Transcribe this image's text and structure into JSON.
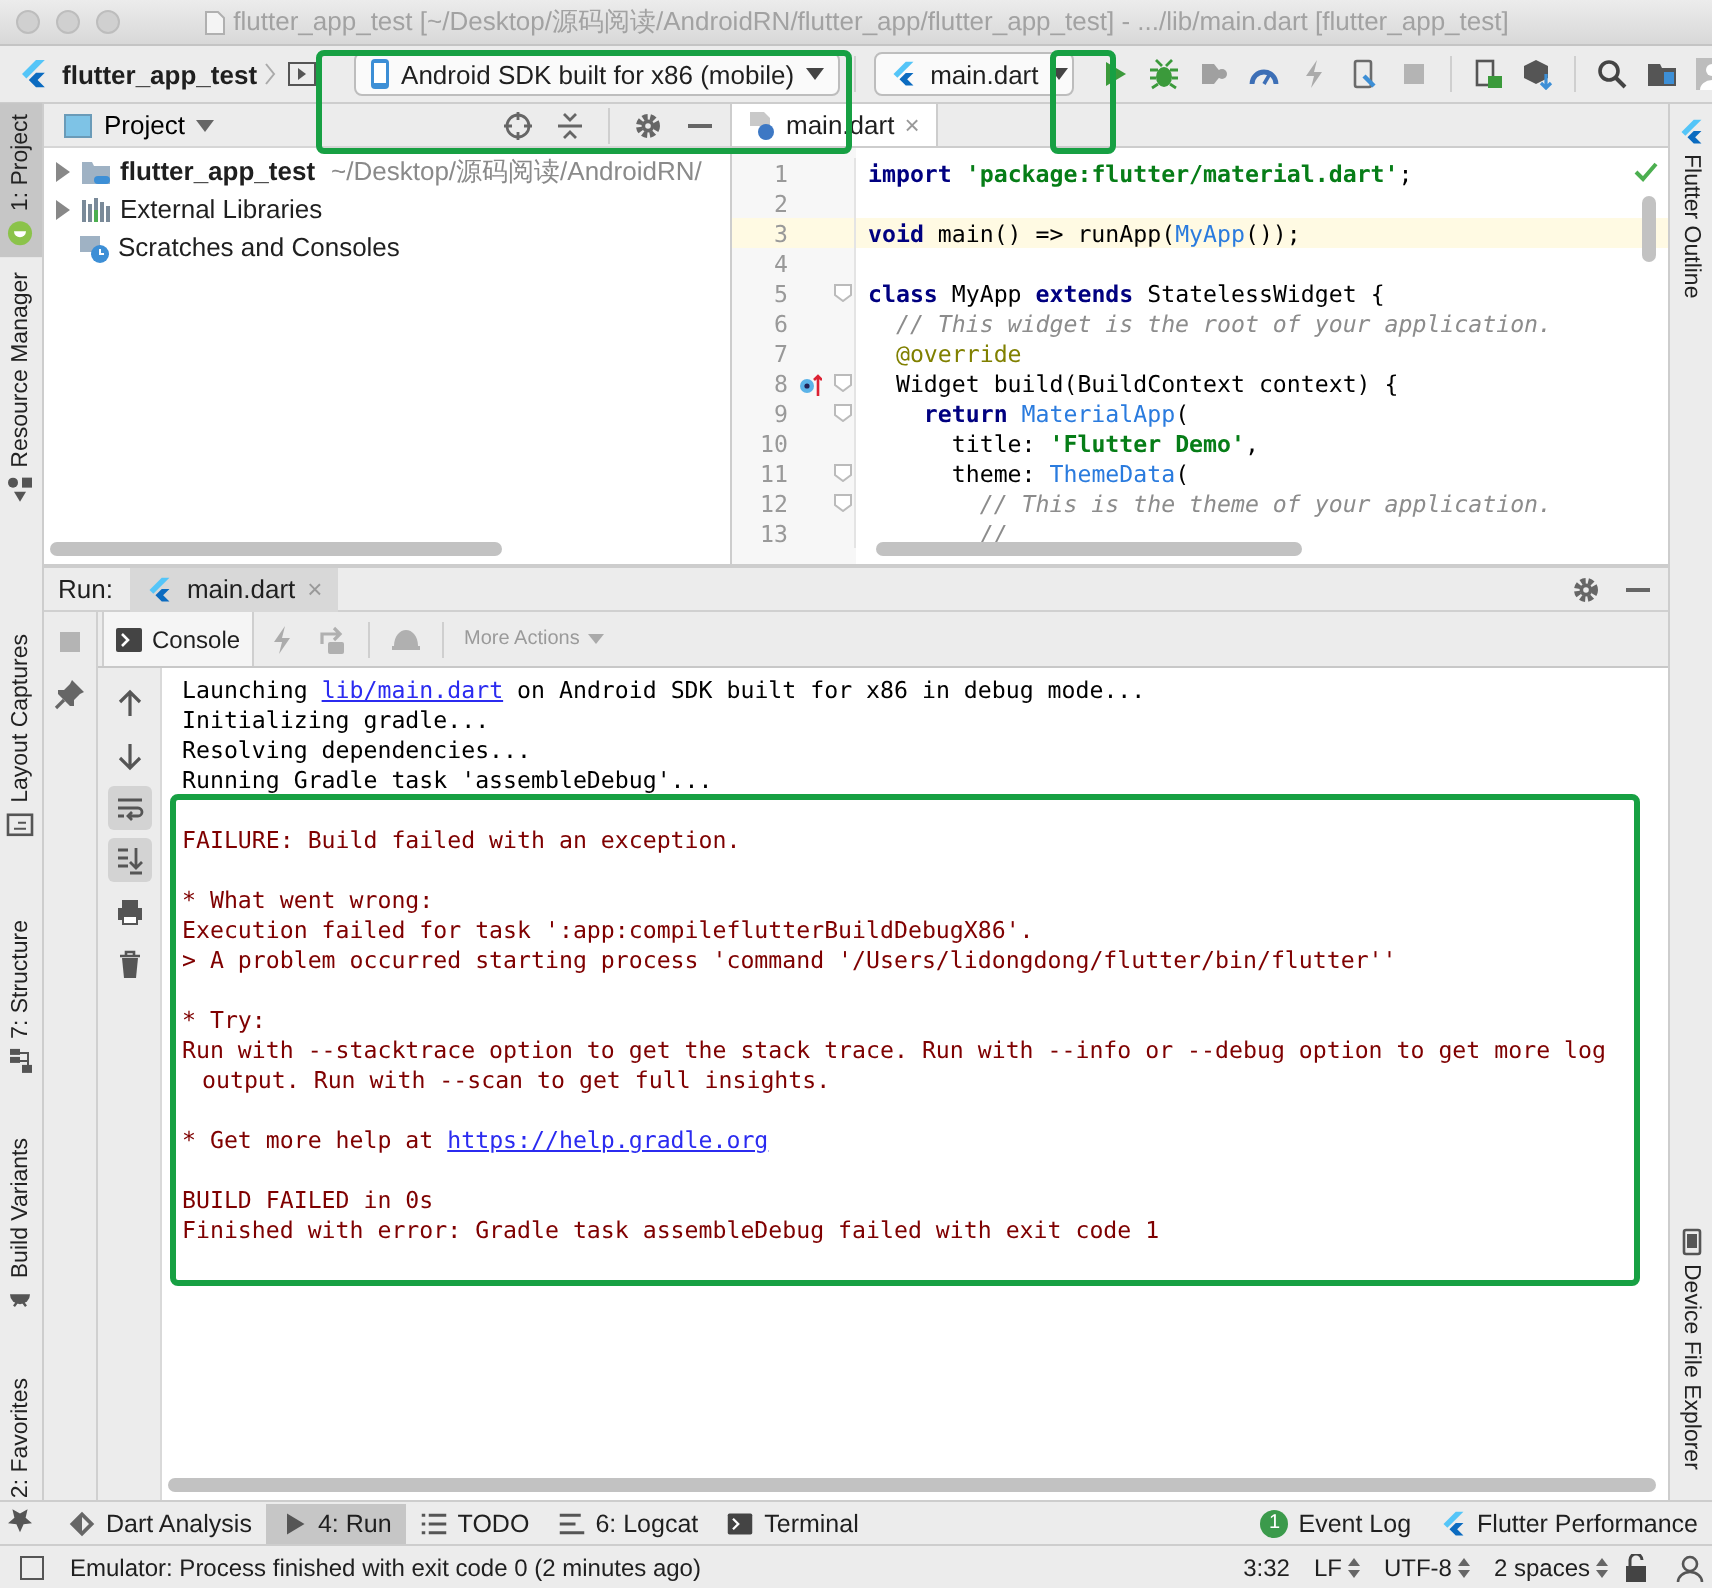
{
  "window": {
    "title": "flutter_app_test [~/Desktop/源码阅读/AndroidRN/flutter_app/flutter_app_test] - .../lib/main.dart [flutter_app_test]"
  },
  "toolbar": {
    "project": "flutter_app_test",
    "device": "Android SDK built for x86 (mobile)",
    "run_config": "main.dart"
  },
  "left_stripe": [
    {
      "label": "1: Project",
      "selected": true,
      "kind": "project"
    },
    {
      "label": "Resource Manager",
      "selected": false,
      "kind": "resources"
    },
    {
      "label": "Layout Captures",
      "selected": false,
      "kind": "captures"
    },
    {
      "label": "7: Structure",
      "selected": false,
      "kind": "structure"
    },
    {
      "label": "Build Variants",
      "selected": false,
      "kind": "variants"
    },
    {
      "label": "2: Favorites",
      "selected": false,
      "kind": "favorites"
    }
  ],
  "right_stripe": [
    {
      "label": "Flutter Outline",
      "selected": false,
      "kind": "outline"
    },
    {
      "label": "Device File Explorer",
      "selected": false,
      "kind": "device"
    }
  ],
  "project_panel": {
    "title": "Project",
    "tree": [
      {
        "name": "flutter_app_test",
        "path": "~/Desktop/源码阅读/AndroidRN/",
        "expanded": false,
        "kind": "module"
      },
      {
        "name": "External Libraries",
        "expanded": false,
        "kind": "libraries"
      },
      {
        "name": "Scratches and Consoles",
        "kind": "scratches"
      }
    ]
  },
  "editor": {
    "tabs": [
      {
        "label": "main.dart",
        "close": "×",
        "selected": true
      }
    ],
    "lines": [
      {
        "number": "1",
        "current": false,
        "fold": false,
        "marker": false,
        "tokens": [
          {
            "text": "import ",
            "kind": "keyword"
          },
          {
            "text": "'package:flutter/material.dart'",
            "kind": "string"
          },
          {
            "text": ";",
            "kind": "plain"
          }
        ]
      },
      {
        "number": "2",
        "current": false,
        "fold": false,
        "marker": false
      },
      {
        "number": "3",
        "current": true,
        "fold": false,
        "marker": false,
        "tokens": [
          {
            "text": "void",
            "kind": "keyword"
          },
          {
            "text": " main() => runApp(",
            "kind": "plain"
          },
          {
            "text": "MyApp",
            "kind": "class"
          },
          {
            "text": "());",
            "kind": "plain"
          }
        ]
      },
      {
        "number": "4",
        "current": false,
        "fold": false,
        "marker": false
      },
      {
        "number": "5",
        "current": false,
        "fold": true,
        "marker": false,
        "tokens": [
          {
            "text": "class",
            "kind": "keyword"
          },
          {
            "text": " MyApp ",
            "kind": "plain"
          },
          {
            "text": "extends",
            "kind": "keyword"
          },
          {
            "text": " StatelessWidget {",
            "kind": "plain"
          }
        ]
      },
      {
        "number": "6",
        "current": false,
        "fold": false,
        "marker": false,
        "tokens": [
          {
            "text": "  // This widget is the root of your application.",
            "kind": "comment"
          }
        ]
      },
      {
        "number": "7",
        "current": false,
        "fold": false,
        "marker": false,
        "tokens": [
          {
            "text": "  @override",
            "kind": "annotation"
          }
        ]
      },
      {
        "number": "8",
        "current": false,
        "fold": true,
        "marker": true,
        "tokens": [
          {
            "text": "  Widget build(BuildContext context) {",
            "kind": "plain"
          }
        ]
      },
      {
        "number": "9",
        "current": false,
        "fold": true,
        "marker": false,
        "tokens": [
          {
            "text": "    return ",
            "kind": "keyword"
          },
          {
            "text": "MaterialApp",
            "kind": "class"
          },
          {
            "text": "(",
            "kind": "plain"
          }
        ]
      },
      {
        "number": "10",
        "current": false,
        "fold": false,
        "marker": false,
        "tokens": [
          {
            "text": "      title: ",
            "kind": "plain"
          },
          {
            "text": "'Flutter Demo'",
            "kind": "string"
          },
          {
            "text": ",",
            "kind": "plain"
          }
        ]
      },
      {
        "number": "11",
        "current": false,
        "fold": true,
        "marker": false,
        "tokens": [
          {
            "text": "      theme: ",
            "kind": "plain"
          },
          {
            "text": "ThemeData",
            "kind": "class"
          },
          {
            "text": "(",
            "kind": "plain"
          }
        ]
      },
      {
        "number": "12",
        "current": false,
        "fold": true,
        "marker": false,
        "tokens": [
          {
            "text": "        // This is the theme of your application.",
            "kind": "comment"
          }
        ]
      },
      {
        "number": "13",
        "current": false,
        "fold": false,
        "marker": false,
        "tokens": [
          {
            "text": "        //",
            "kind": "comment"
          }
        ]
      }
    ]
  },
  "run_panel": {
    "label": "Run:",
    "tabs": [
      {
        "label": "main.dart",
        "close": "×",
        "selected": true
      }
    ],
    "console_tab": "Console",
    "more_actions": "More Actions",
    "tools": [
      {
        "kind": "up",
        "on": false
      },
      {
        "kind": "down",
        "on": false
      },
      {
        "kind": "wrap",
        "on": true
      },
      {
        "kind": "scroll_end",
        "on": true
      },
      {
        "kind": "print",
        "on": false
      },
      {
        "kind": "clear",
        "on": false
      }
    ],
    "console": [
      {
        "kind": "info",
        "lines": [
          {
            "text": "Launching ",
            "link": "lib/main.dart",
            "rest": " on Android SDK built for x86 in debug mode...",
            "wrapped": false
          },
          {
            "text": "Initializing gradle...",
            "wrapped": false
          },
          {
            "text": "Resolving dependencies...",
            "wrapped": false
          },
          {
            "text": "Running Gradle task 'assembleDebug'...",
            "wrapped": false
          }
        ]
      },
      {
        "kind": "error",
        "lines": [
          {
            "text": "FAILURE: Build failed with an exception.",
            "wrapped": false
          }
        ]
      },
      {
        "kind": "error",
        "lines": [
          {
            "text": "* What went wrong:",
            "wrapped": false
          },
          {
            "text": "Execution failed for task ':app:compileflutterBuildDebugX86'.",
            "wrapped": false
          },
          {
            "text": "> A problem occurred starting process 'command '/Users/lidongdong/flutter/bin/flutter''",
            "wrapped": false
          }
        ]
      },
      {
        "kind": "error",
        "lines": [
          {
            "text": "* Try:",
            "wrapped": false
          },
          {
            "text": "Run with --stacktrace option to get the stack trace. Run with --info or --debug option to get more log",
            "wrapped": false
          },
          {
            "text": "output. Run with --scan to get full insights.",
            "wrapped": true
          }
        ]
      },
      {
        "kind": "error",
        "lines": [
          {
            "text": "* Get more help at ",
            "link": "https://help.gradle.org",
            "wrapped": false
          }
        ]
      },
      {
        "kind": "error",
        "lines": [
          {
            "text": "BUILD FAILED in 0s",
            "wrapped": false
          },
          {
            "text": "Finished with error: Gradle task assembleDebug failed with exit code 1",
            "wrapped": false
          }
        ]
      }
    ]
  },
  "bottom_tabs": [
    {
      "label": "Dart Analysis",
      "selected": false,
      "kind": "analysis"
    },
    {
      "label": "4: Run",
      "selected": true,
      "kind": "run"
    },
    {
      "label": "TODO",
      "selected": false,
      "kind": "todo"
    },
    {
      "label": "6: Logcat",
      "selected": false,
      "kind": "logcat"
    },
    {
      "label": "Terminal",
      "selected": false,
      "kind": "terminal"
    }
  ],
  "bottom_tabs_right": [
    {
      "label": "Event Log",
      "badge": "1",
      "selected": false,
      "kind": "events"
    },
    {
      "label": "Flutter Performance",
      "selected": false,
      "kind": "performance"
    }
  ],
  "status_bar": {
    "message": "Emulator: Process finished with exit code 0 (2 minutes ago)",
    "position": "3:32",
    "line_separator": "LF",
    "encoding": "UTF-8",
    "indent": "2 spaces"
  }
}
